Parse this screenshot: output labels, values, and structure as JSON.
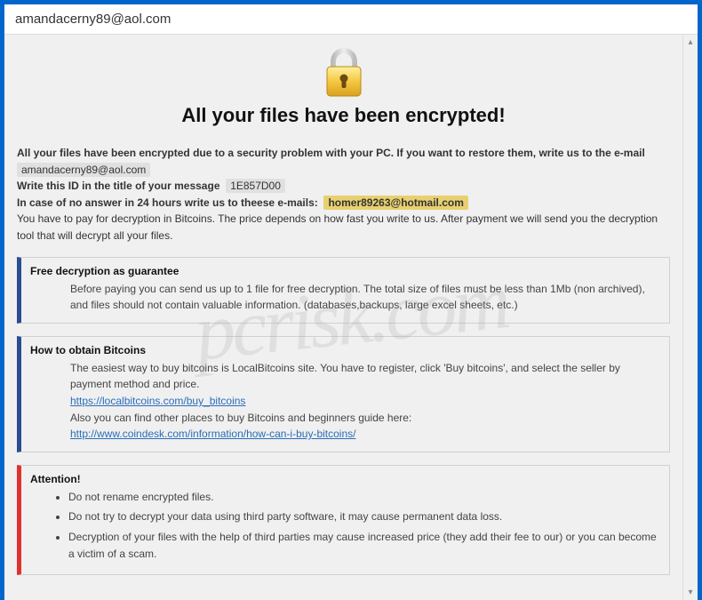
{
  "window": {
    "title": "amandacerny89@aol.com"
  },
  "lock": {
    "alt": "lock-icon"
  },
  "heading": "All your files have been encrypted!",
  "intro": {
    "line1_pre": "All your files have been encrypted due to a security problem with your PC. If you want to restore them, write us to the e-mail",
    "email1": "amandacerny89@aol.com",
    "line2_pre": "Write this ID in the title of your message",
    "id_value": "1E857D00",
    "line3_pre": "In case of no answer in 24 hours write us to theese e-mails:",
    "email2": "homer89263@hotmail.com",
    "line4": "You have to pay for decryption in Bitcoins. The price depends on how fast you write to us. After payment we will send you the decryption tool that will decrypt all your files."
  },
  "panel_free": {
    "title": "Free decryption as guarantee",
    "body": "Before paying you can send us up to 1 file for free decryption. The total size of files must be less than 1Mb (non archived), and files should not contain valuable information. (databases,backups, large excel sheets, etc.)"
  },
  "panel_btc": {
    "title": "How to obtain Bitcoins",
    "line1": "The easiest way to buy bitcoins is LocalBitcoins site. You have to register, click 'Buy bitcoins', and select the seller by payment method and price.",
    "link1": "https://localbitcoins.com/buy_bitcoins",
    "line2": "Also you can find other places to buy Bitcoins and beginners guide here:",
    "link2": "http://www.coindesk.com/information/how-can-i-buy-bitcoins/"
  },
  "panel_attn": {
    "title": "Attention!",
    "item1": "Do not rename encrypted files.",
    "item2": "Do not try to decrypt your data using third party software, it may cause permanent data loss.",
    "item3": "Decryption of your files with the help of third parties may cause increased price (they add their fee to our) or you can become a victim of a scam."
  },
  "watermark": "pcrisk.com"
}
